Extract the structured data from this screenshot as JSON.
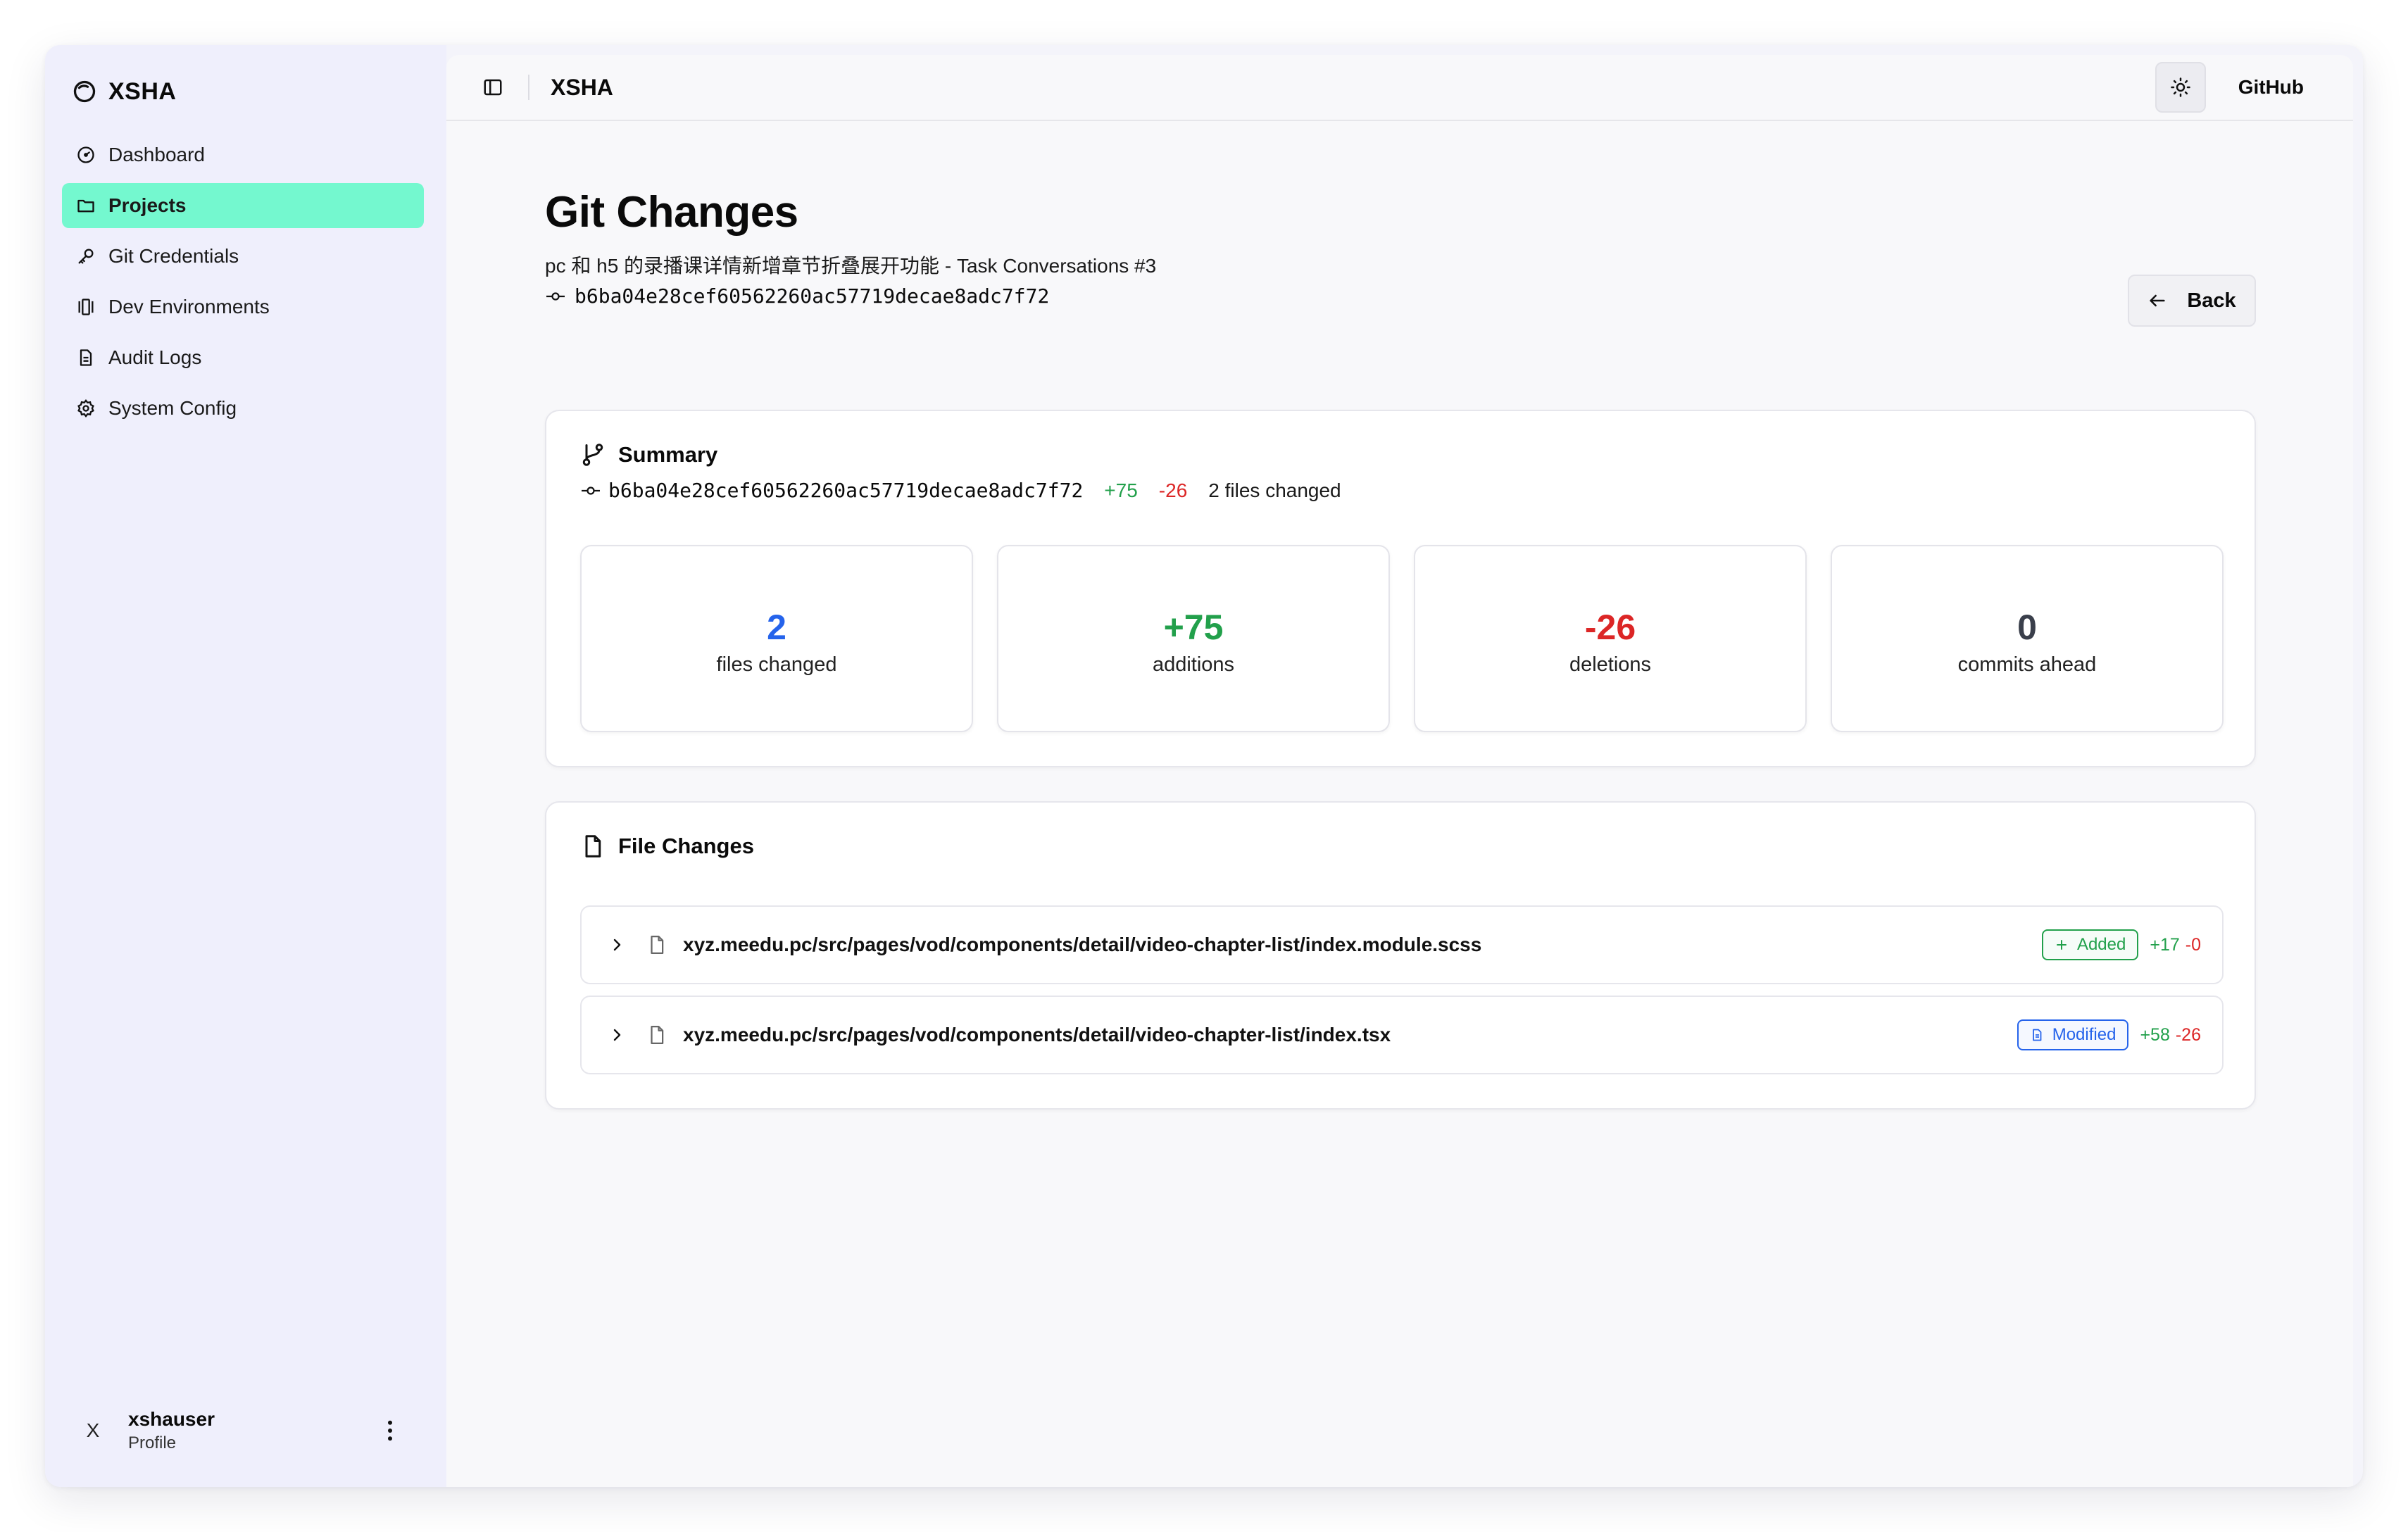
{
  "app": {
    "brand": "XSHA"
  },
  "sidebar": {
    "items": [
      {
        "label": "Dashboard",
        "icon": "dashboard-icon"
      },
      {
        "label": "Projects",
        "icon": "folder-icon",
        "active": true
      },
      {
        "label": "Git Credentials",
        "icon": "key-icon"
      },
      {
        "label": "Dev Environments",
        "icon": "container-icon"
      },
      {
        "label": "Audit Logs",
        "icon": "file-text-icon"
      },
      {
        "label": "System Config",
        "icon": "gear-icon"
      }
    ],
    "user": {
      "avatar": "X",
      "name": "xshauser",
      "subtitle": "Profile"
    }
  },
  "topbar": {
    "title": "XSHA",
    "github_label": "GitHub"
  },
  "page": {
    "title": "Git Changes",
    "subtitle": "pc 和 h5 的录播课详情新增章节折叠展开功能 - Task Conversations #3",
    "commit_hash": "b6ba04e28cef60562260ac57719decae8adc7f72",
    "back_label": "Back"
  },
  "summary": {
    "title": "Summary",
    "commit_hash": "b6ba04e28cef60562260ac57719decae8adc7f72",
    "additions_text": "+75",
    "deletions_text": "-26",
    "files_changed_text": "2 files changed",
    "stats": [
      {
        "value": "2",
        "label": "files changed",
        "color": "#2563eb"
      },
      {
        "value": "+75",
        "label": "additions",
        "color": "#22a04b"
      },
      {
        "value": "-26",
        "label": "deletions",
        "color": "#dc2626"
      },
      {
        "value": "0",
        "label": "commits ahead",
        "color": "#3a3f4b"
      }
    ]
  },
  "file_changes": {
    "title": "File Changes",
    "files": [
      {
        "path": "xyz.meedu.pc/src/pages/vod/components/detail/video-chapter-list/index.module.scss",
        "status": "Added",
        "additions": "+17",
        "deletions": "-0"
      },
      {
        "path": "xyz.meedu.pc/src/pages/vod/components/detail/video-chapter-list/index.tsx",
        "status": "Modified",
        "additions": "+58",
        "deletions": "-26"
      }
    ]
  }
}
